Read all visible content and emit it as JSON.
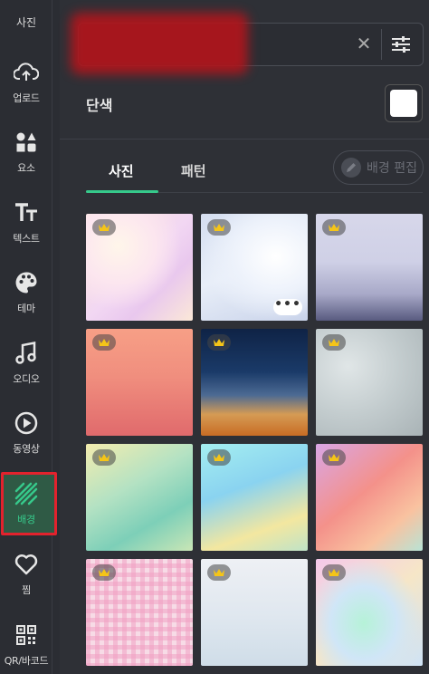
{
  "sidebar": {
    "top_label": "사진",
    "items": [
      {
        "label": "업로드",
        "icon": "upload-cloud-icon"
      },
      {
        "label": "요소",
        "icon": "shapes-icon"
      },
      {
        "label": "텍스트",
        "icon": "text-icon"
      },
      {
        "label": "테마",
        "icon": "palette-icon"
      },
      {
        "label": "오디오",
        "icon": "music-note-icon"
      },
      {
        "label": "동영상",
        "icon": "play-circle-icon"
      },
      {
        "label": "배경",
        "icon": "background-stripes-icon",
        "active": true
      },
      {
        "label": "찜",
        "icon": "heart-icon"
      },
      {
        "label": "QR/바코드",
        "icon": "qr-code-icon"
      }
    ]
  },
  "search": {
    "value": "",
    "placeholder": "",
    "clear_icon": "close-icon",
    "filter_icon": "sliders-icon"
  },
  "solid": {
    "label": "단색",
    "color": "#ffffff"
  },
  "tabs": [
    {
      "label": "사진",
      "active": true
    },
    {
      "label": "패턴",
      "active": false
    }
  ],
  "edit_button": {
    "label": "배경 편집",
    "enabled": false
  },
  "accent_color": "#36c98b",
  "tiles": [
    {
      "premium": true,
      "more": false
    },
    {
      "premium": true,
      "more": true,
      "more_label": "•••"
    },
    {
      "premium": true,
      "more": false
    },
    {
      "premium": true,
      "more": false
    },
    {
      "premium": true,
      "more": false
    },
    {
      "premium": true,
      "more": false
    },
    {
      "premium": true,
      "more": false
    },
    {
      "premium": true,
      "more": false
    },
    {
      "premium": true,
      "more": false
    },
    {
      "premium": true,
      "more": false
    },
    {
      "premium": true,
      "more": false
    },
    {
      "premium": true,
      "more": false
    }
  ]
}
